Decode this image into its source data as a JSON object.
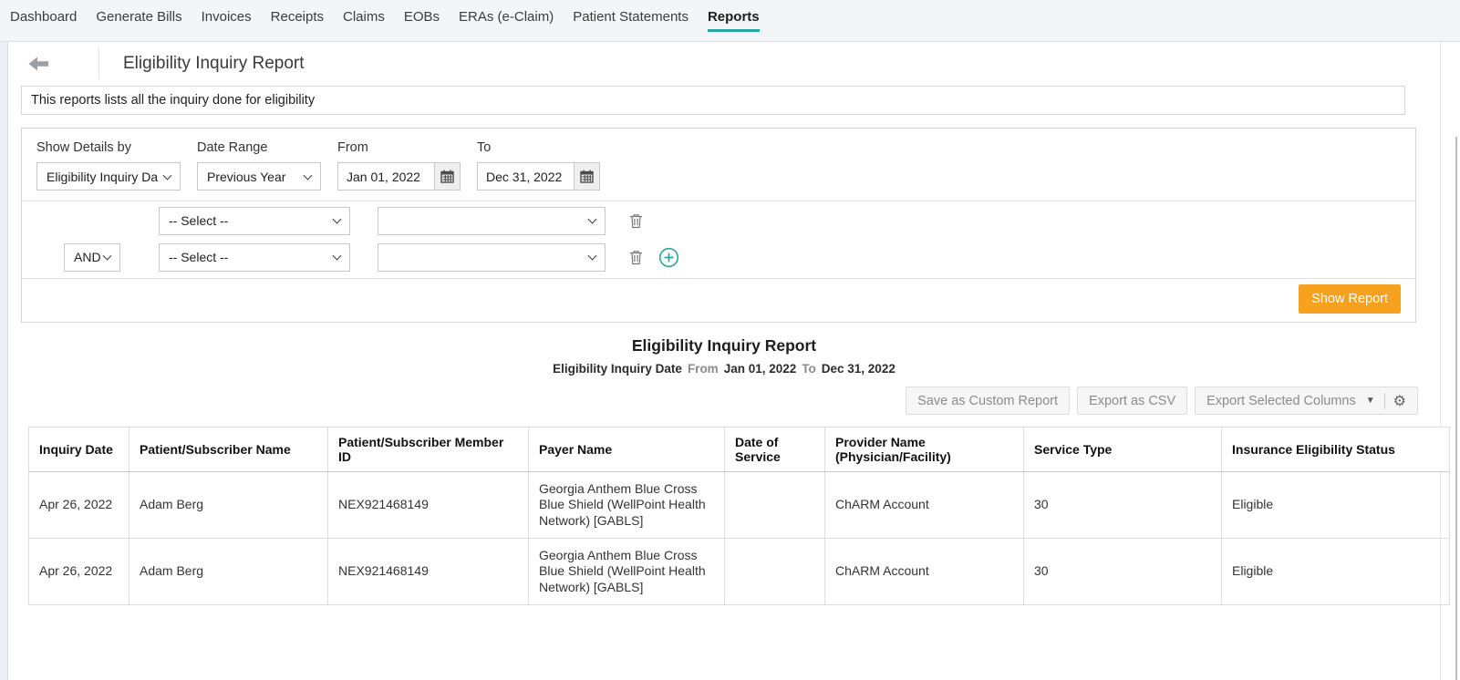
{
  "colors": {
    "accent": "#2aa7a0",
    "primary_button": "#f6a21e"
  },
  "nav": {
    "items": [
      "Dashboard",
      "Generate Bills",
      "Invoices",
      "Receipts",
      "Claims",
      "EOBs",
      "ERAs (e-Claim)",
      "Patient Statements",
      "Reports"
    ],
    "active_item": "Reports"
  },
  "header": {
    "title": "Eligibility Inquiry Report"
  },
  "description": "This reports lists all the inquiry done for eligibility",
  "filters": {
    "show_details_by": {
      "label": "Show Details by",
      "value": "Eligibility Inquiry Da"
    },
    "date_range": {
      "label": "Date Range",
      "value": "Previous Year"
    },
    "from": {
      "label": "From",
      "value": "Jan 01, 2022"
    },
    "to": {
      "label": "To",
      "value": "Dec 31, 2022"
    },
    "condition_rows": [
      {
        "field": "-- Select --",
        "value": ""
      },
      {
        "operator": "AND",
        "field": "-- Select --",
        "value": ""
      }
    ],
    "show_report_label": "Show Report"
  },
  "report": {
    "title": "Eligibility Inquiry Report",
    "subtitle": {
      "field": "Eligibility Inquiry Date",
      "from_label": "From",
      "from_value": "Jan 01, 2022",
      "to_label": "To",
      "to_value": "Dec 31, 2022"
    },
    "actions": {
      "save_custom_report": "Save as Custom Report",
      "export_csv": "Export as CSV",
      "export_selected_columns": "Export Selected Columns"
    }
  },
  "table": {
    "columns": [
      "Inquiry Date",
      "Patient/Subscriber Name",
      "Patient/Subscriber Member ID",
      "Payer Name",
      "Date of Service",
      "Provider Name (Physician/Facility)",
      "Service Type",
      "Insurance Eligibility Status"
    ],
    "rows": [
      [
        "Apr 26, 2022",
        "Adam Berg",
        "NEX921468149",
        "Georgia Anthem Blue Cross Blue Shield (WellPoint Health Network) [GABLS]",
        "",
        "ChARM Account",
        "30",
        "Eligible"
      ],
      [
        "Apr 26, 2022",
        "Adam Berg",
        "NEX921468149",
        "Georgia Anthem Blue Cross Blue Shield (WellPoint Health Network) [GABLS]",
        "",
        "ChARM Account",
        "30",
        "Eligible"
      ]
    ]
  },
  "icons": {
    "back": "arrow-left",
    "calendar": "calendar",
    "remove_condition": "trash",
    "add_condition": "plus-circle",
    "export_menu": "chevron-down",
    "settings": "gear"
  }
}
